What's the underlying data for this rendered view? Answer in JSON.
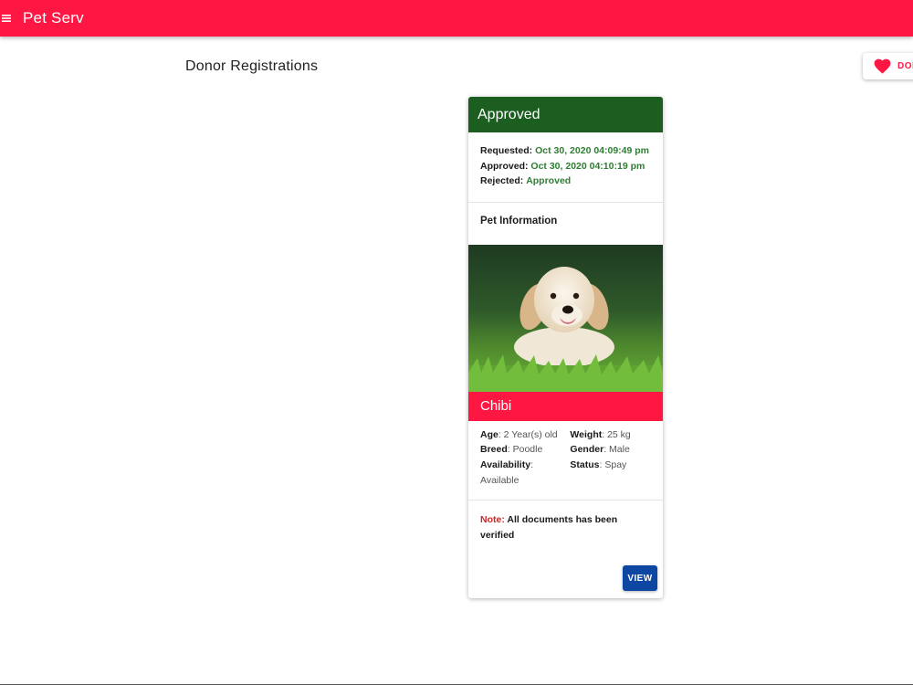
{
  "app": {
    "title": "Pet Serv",
    "menu_icon": "hamburger-menu-icon"
  },
  "page": {
    "title": "Donor Registrations"
  },
  "donate_button": {
    "label": "DONATE",
    "icon": "heart-icon",
    "color": "#ff1744"
  },
  "card": {
    "status": "Approved",
    "status_color": "#1b5e20",
    "requested_label": "Requested:",
    "requested_value": "Oct 30, 2020 04:09:49 pm",
    "approved_label": "Approved:",
    "approved_value": "Oct 30, 2020 04:10:19 pm",
    "rejected_label": "Rejected:",
    "rejected_value": "Approved",
    "section_title": "Pet Information",
    "pet_name": "Chibi",
    "age_label": "Age",
    "age_value": ": 2 Year(s) old",
    "breed_label": "Breed",
    "breed_value": ": Poodle",
    "availability_label": "Availability",
    "availability_sep": ":",
    "availability_value": "Available",
    "weight_label": "Weight",
    "weight_value": ": 25 kg",
    "gender_label": "Gender",
    "gender_value": ": Male",
    "status_label": "Status",
    "status_value": ": Spay",
    "note_label": "Note:",
    "note_text": "All documents has been verified",
    "view_label": "VIEW"
  },
  "colors": {
    "accent": "#ff1744",
    "primary": "#0d47a1",
    "success": "#2e7d32"
  }
}
